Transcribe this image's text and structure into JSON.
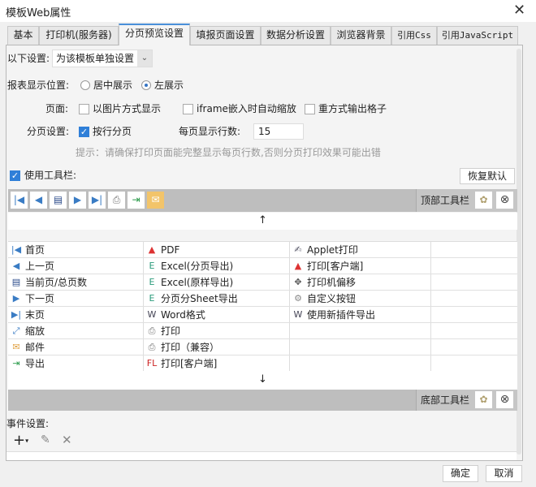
{
  "window": {
    "title": "模板Web属性"
  },
  "tabs": [
    "基本",
    "打印机(服务器)",
    "分页预览设置",
    "填报页面设置",
    "数据分析设置",
    "浏览器背景",
    "引用Css",
    "引用JavaScript"
  ],
  "settings": {
    "scope_label": "以下设置:",
    "scope_value": "为该模板单独设置",
    "position_label": "报表显示位置:",
    "position_options": [
      "居中展示",
      "左展示"
    ],
    "page_label": "页面:",
    "page_options": [
      "以图片方式显示",
      "iframe嵌入时自动缩放",
      "重方式输出格子"
    ],
    "paging_label": "分页设置:",
    "paging_option": "按行分页",
    "rows_label": "每页显示行数:",
    "rows_value": "15",
    "hint": "提示：请确保打印页面能完整显示每页行数,否则分页打印效果可能出错",
    "use_toolbar": "使用工具栏:",
    "restore_default": "恢复默认"
  },
  "toolbar": {
    "top_label": "顶部工具栏",
    "bottom_label": "底部工具栏"
  },
  "grid": [
    [
      "首页",
      "PDF",
      "Applet打印",
      ""
    ],
    [
      "上一页",
      "Excel(分页导出)",
      "打印[客户端]",
      ""
    ],
    [
      "当前页/总页数",
      "Excel(原样导出)",
      "打印机偏移",
      ""
    ],
    [
      "下一页",
      "分页分Sheet导出",
      "自定义按钮",
      ""
    ],
    [
      "末页",
      "Word格式",
      "使用新插件导出",
      ""
    ],
    [
      "缩放",
      "打印",
      "",
      ""
    ],
    [
      "邮件",
      "打印（兼容）",
      "",
      ""
    ],
    [
      "导出",
      "打印[客户端]",
      "",
      ""
    ]
  ],
  "events": {
    "label": "事件设置:"
  },
  "footer": {
    "ok": "确定",
    "cancel": "取消"
  }
}
